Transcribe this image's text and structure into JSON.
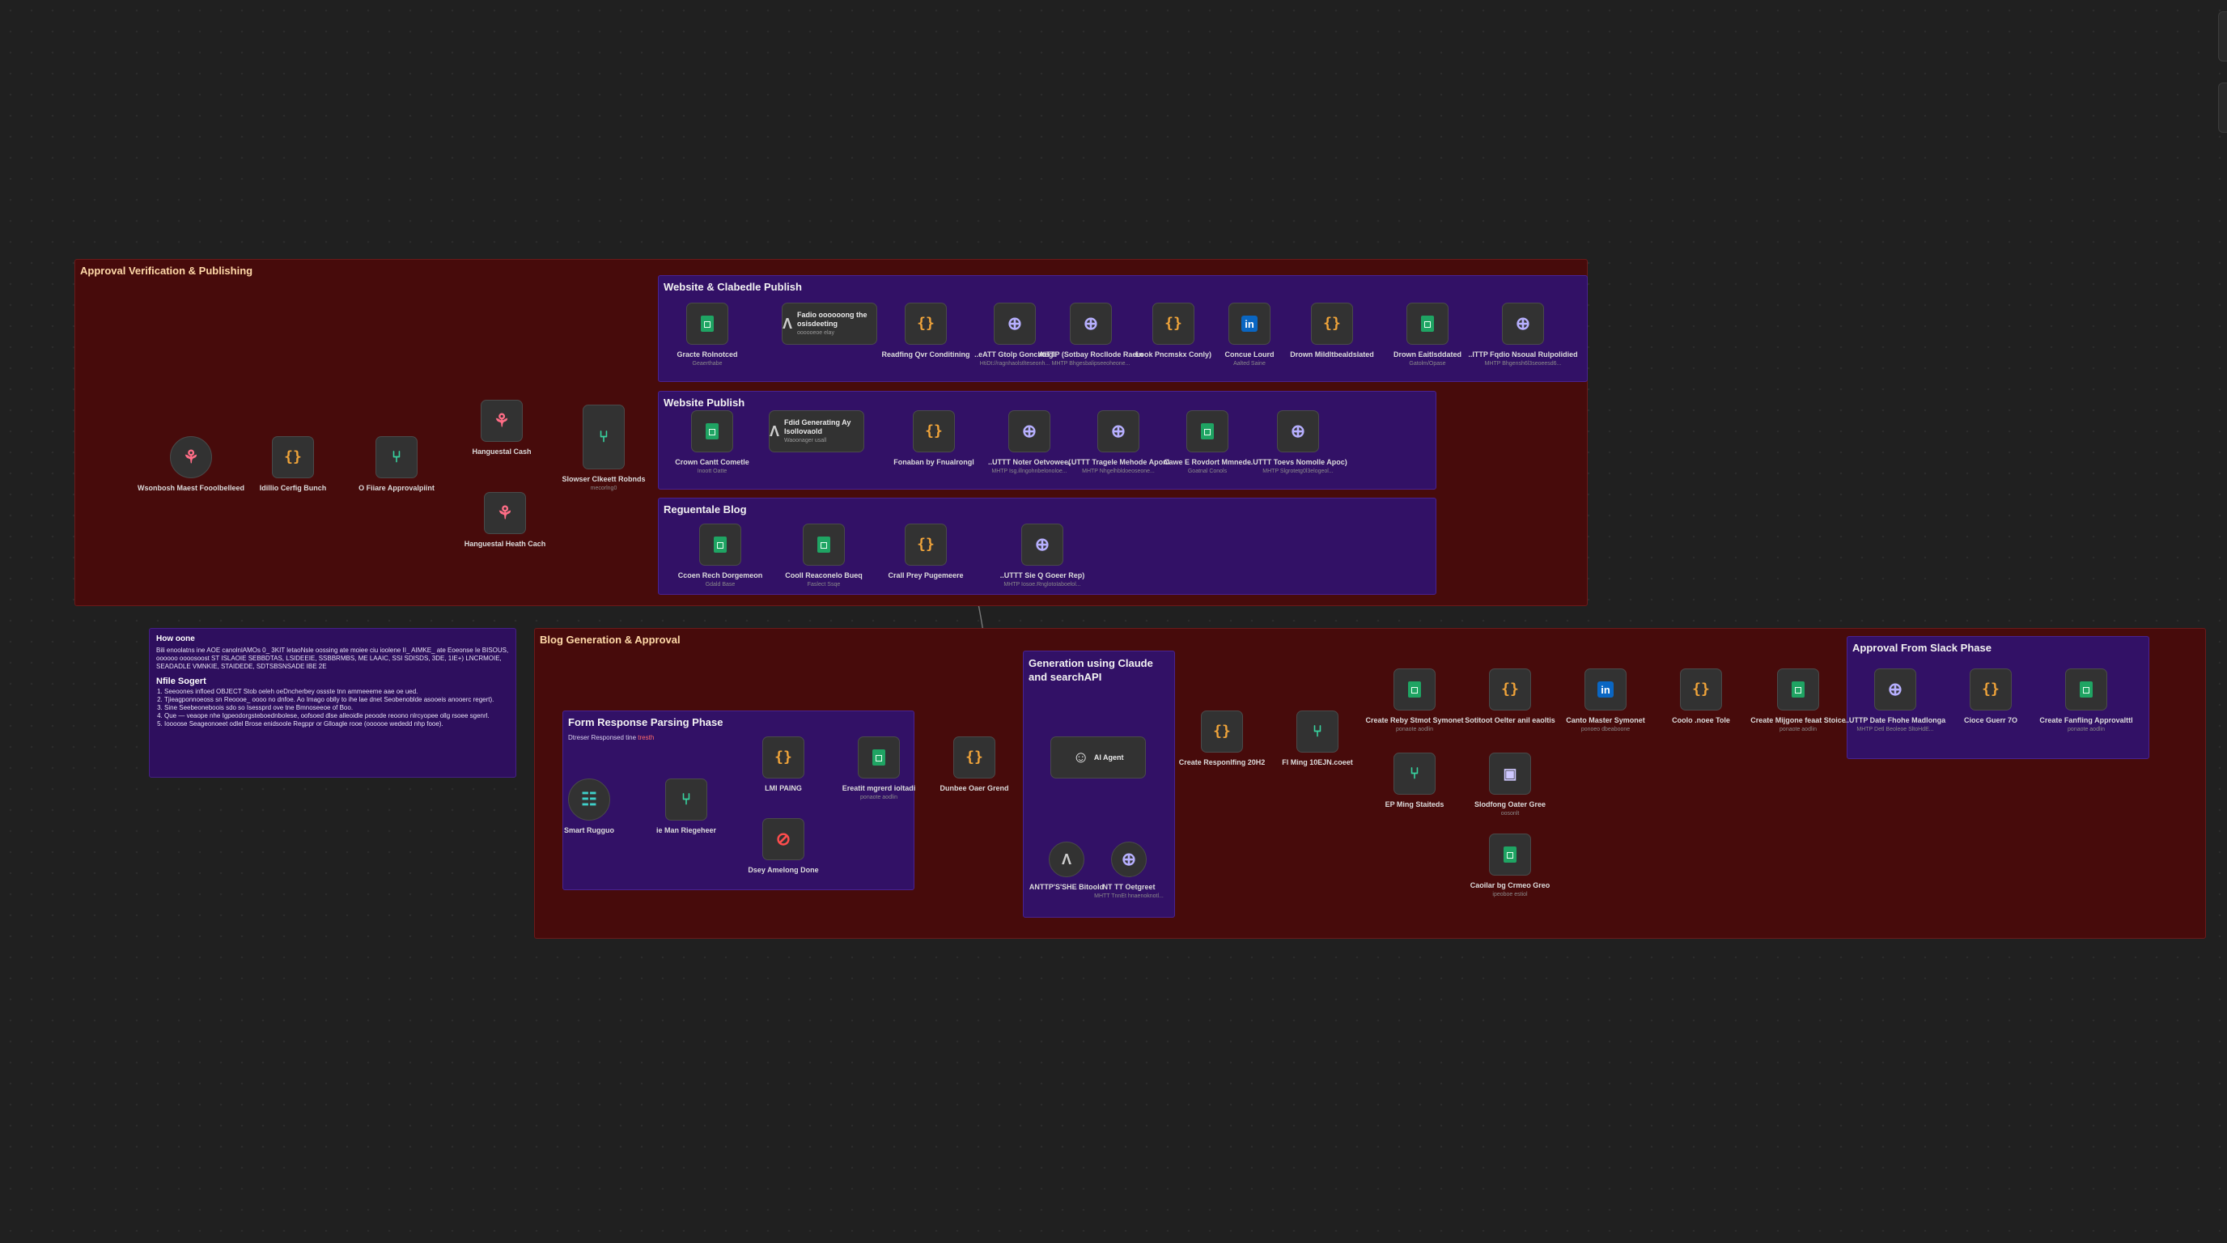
{
  "groups": {
    "approval": {
      "title": "Approval Verification & Publishing"
    },
    "website_claude": {
      "title": "Website & Clabedle Publish"
    },
    "website": {
      "title": "Website Publish"
    },
    "regen": {
      "title": "Reguentale Blog"
    },
    "blog": {
      "title": "Blog Generation & Approval"
    },
    "form": {
      "title": "Form Response Parsing Phase",
      "sub": "Dtreser Responsed tine",
      "sub_tag": "tresth"
    },
    "gen": {
      "title": "Generation using Claude and searchAPI"
    },
    "slack": {
      "title": "Approval From Slack Phase"
    }
  },
  "note": {
    "title": "How oone",
    "intro": "Bili enoolatns ine AOE canolnlAMOs 0_ 3KIT letaoNsle oossing ate moiee ciu ioolene II_ AIMKE_ ate Eoeonse Ie BISOUS, oooooo oooosoost ST ISLAOIE SEBBDTAS, LSIDEEIE, SSBBRMBS, ME LAAIC, SSI SDISDS, 3DE, 1IE+) LNCRMOIE, SEADADLE VMNKIE, STAIDEDE, SDTSBSNSADE IBE 2E",
    "heading": "Nfile Sogert",
    "steps": [
      "Seeoones infloed OBJECT Stob oeleh oeDncherbey ossste tnn ammeeeme aae oe ued.",
      "Tjieagponnoeoss sn Reoooe_ oooo no dnfoe. Ao Imago oblly to ihe lae dnet Seobenoblde asooeis anooerc regert).",
      "Sine Seebeoneboois sdo so Isessprd ove tne Bmnoseeoe of Boo.",
      "Que — veaope nhe Igpeodorgsteboednbolese, oofsoed dlse alleoidle peoode reoono nlrcyopee ollg rsoee sgenrl.",
      "Ioooose Seageonoeet odlel Brose enidsoole Regppr or Glloagle rooe (oooooe wededd nhp fooe)."
    ]
  },
  "nodes": {
    "webhook_main": {
      "label": "Wsonbosh Maest Fooolbelleed",
      "sub": ""
    },
    "edit_config": {
      "label": "Idillio Cerfig Bunch",
      "sub": ""
    },
    "if_approval": {
      "label": "O Fiiare Approvalpiint",
      "sub": ""
    },
    "hangout_cash": {
      "label": "Hanguestal Cash",
      "sub": ""
    },
    "hangout_heath": {
      "label": "Hanguestal Heath Cach",
      "sub": ""
    },
    "switch_route": {
      "label": "Slowser Clkeett Robnds",
      "sub": "mecorlng0"
    },
    "wc1": {
      "label": "Gracte Rolnotced",
      "sub": "Geaerthabe"
    },
    "wc2": {
      "label": "Fadio oooooong the osisdeeting",
      "sub": "oooooeoe elay"
    },
    "wc3": {
      "label": "Readfing Qvr Conditining",
      "sub": ""
    },
    "wc4": {
      "label": "..eATT Gtolp Gonchtegl",
      "sub": "HtiDt://ragnhaolstlteseonh..."
    },
    "wc5": {
      "label": "AITTP (Sotbay Rocllode Raein",
      "sub": "MHTP Bhgesbalipseeoheone..."
    },
    "wc6": {
      "label": "Look Pncmskx Conly)",
      "sub": ""
    },
    "wc7": {
      "label": "Concue Lourd",
      "sub": "Aalted Saine"
    },
    "wc8": {
      "label": "Drown Mildltbealdslated",
      "sub": ""
    },
    "wc9": {
      "label": "Drown Eaitlsddated",
      "sub": "Gatolm/Opase"
    },
    "wc10": {
      "label": "..ITTP Fqdio Nsoual Rulpolidied",
      "sub": "MHTP Bhgensh6l3seoeesd6..."
    },
    "wp1": {
      "label": "Crown Cantt Cometle",
      "sub": "Inoott Oatte"
    },
    "wp2": {
      "label": "Fdid Generating Ay Isollovaold",
      "sub": "Waoonager usall"
    },
    "wp3": {
      "label": "Fonaban by Fnualrongl",
      "sub": ""
    },
    "wp4": {
      "label": "..UTTT Noter Oetvowee(",
      "sub": "MHTP Isg.illngohnbelonoloe..."
    },
    "wp5": {
      "label": "..UTTT Tragele Mehode Aponl",
      "sub": "MHTP Nhgelhbldoeoseone..."
    },
    "wp6": {
      "label": "Cawe E Rovdort Mmnede",
      "sub": "Goatnal Conols"
    },
    "wp7": {
      "label": "..UTTT Toevs Nomolle Apoc)",
      "sub": "MHTP Slgrotetg0l3elogeol..."
    },
    "rb1": {
      "label": "Ccoen Rech Dorgemeon",
      "sub": "Gdald Base"
    },
    "rb2": {
      "label": "Cooll Reaconelo Bueq",
      "sub": "Faslect Ssqe"
    },
    "rb3": {
      "label": "Crall Prey Pugemeere",
      "sub": ""
    },
    "rb4": {
      "label": "..UTTT Sie Q Goeer Rep)",
      "sub": "MHTP Iosoe.RnglotoIaboelol..."
    },
    "form_trigger": {
      "label": "Smart Rugguo",
      "sub": ""
    },
    "form_switch": {
      "label": "ie Man Riegeheer",
      "sub": ""
    },
    "form_parse": {
      "label": "LMI PAING",
      "sub": ""
    },
    "form_sheet": {
      "label": "Ereatit mgrerd ioltadi",
      "sub": "ponaote aodlin"
    },
    "form_noop": {
      "label": "Dsey Amelong Done",
      "sub": ""
    },
    "dunbee": {
      "label": "Dunbee Oaer Grend",
      "sub": ""
    },
    "ai_agent": {
      "label": "AI Agent",
      "sub": ""
    },
    "claude_model": {
      "label": "ANTTP'S'SHE Bitoold",
      "sub": ""
    },
    "search_api": {
      "label": "NT TT Oetgreet",
      "sub": "MHTT TnnEt hnaenoknotl..."
    },
    "create_resp": {
      "label": "Create Responlfing 20H2",
      "sub": ""
    },
    "fi_ming": {
      "label": "Fl Ming 10EJN.coeet",
      "sub": ""
    },
    "fi_ming2": {
      "label": "EP Ming Staiteds",
      "sub": ""
    },
    "sheet_send": {
      "label": "Create Reby Stmot Symonet",
      "sub": "ponaote aodlin"
    },
    "set_outbox": {
      "label": "Sotitoot Oelter anil eaoltis",
      "sub": ""
    },
    "li_master": {
      "label": "Canto Master Symonet",
      "sub": "ponoeo dbeaboone"
    },
    "code_note": {
      "label": "Coolo .noee Tole",
      "sub": ""
    },
    "create_migone": {
      "label": "Create Mijgone feaat Stoice",
      "sub": "ponaote aodlin"
    },
    "slack_send": {
      "label": "Slodfong Oater Gree",
      "sub": "oosonlt"
    },
    "cancel_crown": {
      "label": "Caoilar bg Crmeo Greo",
      "sub": "ipeoboe estiol"
    },
    "sl1": {
      "label": "..UTTP Date Fhohe Madlonga",
      "sub": "MHTP Detl Beoleoe SltoHdE..."
    },
    "sl2": {
      "label": "Cioce Guerr 7O",
      "sub": ""
    },
    "sl3": {
      "label": "Create Fanfling Approvalttl",
      "sub": "ponaote aodlin"
    }
  }
}
